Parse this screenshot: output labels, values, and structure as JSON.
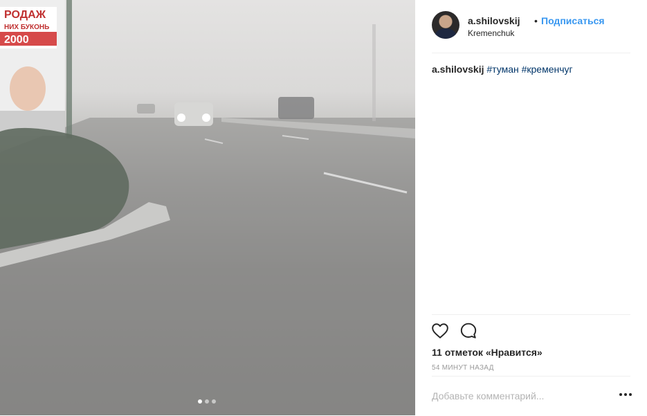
{
  "post": {
    "username": "a.shilovskij",
    "separator": "•",
    "follow_label": "Подписаться",
    "location": "Kremenchuk",
    "caption": {
      "username": "a.shilovskij",
      "hashtags": [
        "#туман",
        "#кременчуг"
      ]
    },
    "likes_text": "11 отметок «Нравится»",
    "time_text": "54 минут назад",
    "comment_placeholder": "Добавьте комментарий...",
    "carousel": {
      "count": 3,
      "active_index": 0
    },
    "photo_sign": {
      "line1": "РОДАЖ",
      "line2": "НИХ БУКОНЬ",
      "price": "2000"
    }
  },
  "icons": {
    "like": "heart-icon",
    "comment": "comment-icon",
    "more": "more-options-icon"
  },
  "colors": {
    "follow": "#3897f0",
    "hashtag": "#003569",
    "text": "#262626",
    "muted": "#999999",
    "divider": "#efefef"
  }
}
